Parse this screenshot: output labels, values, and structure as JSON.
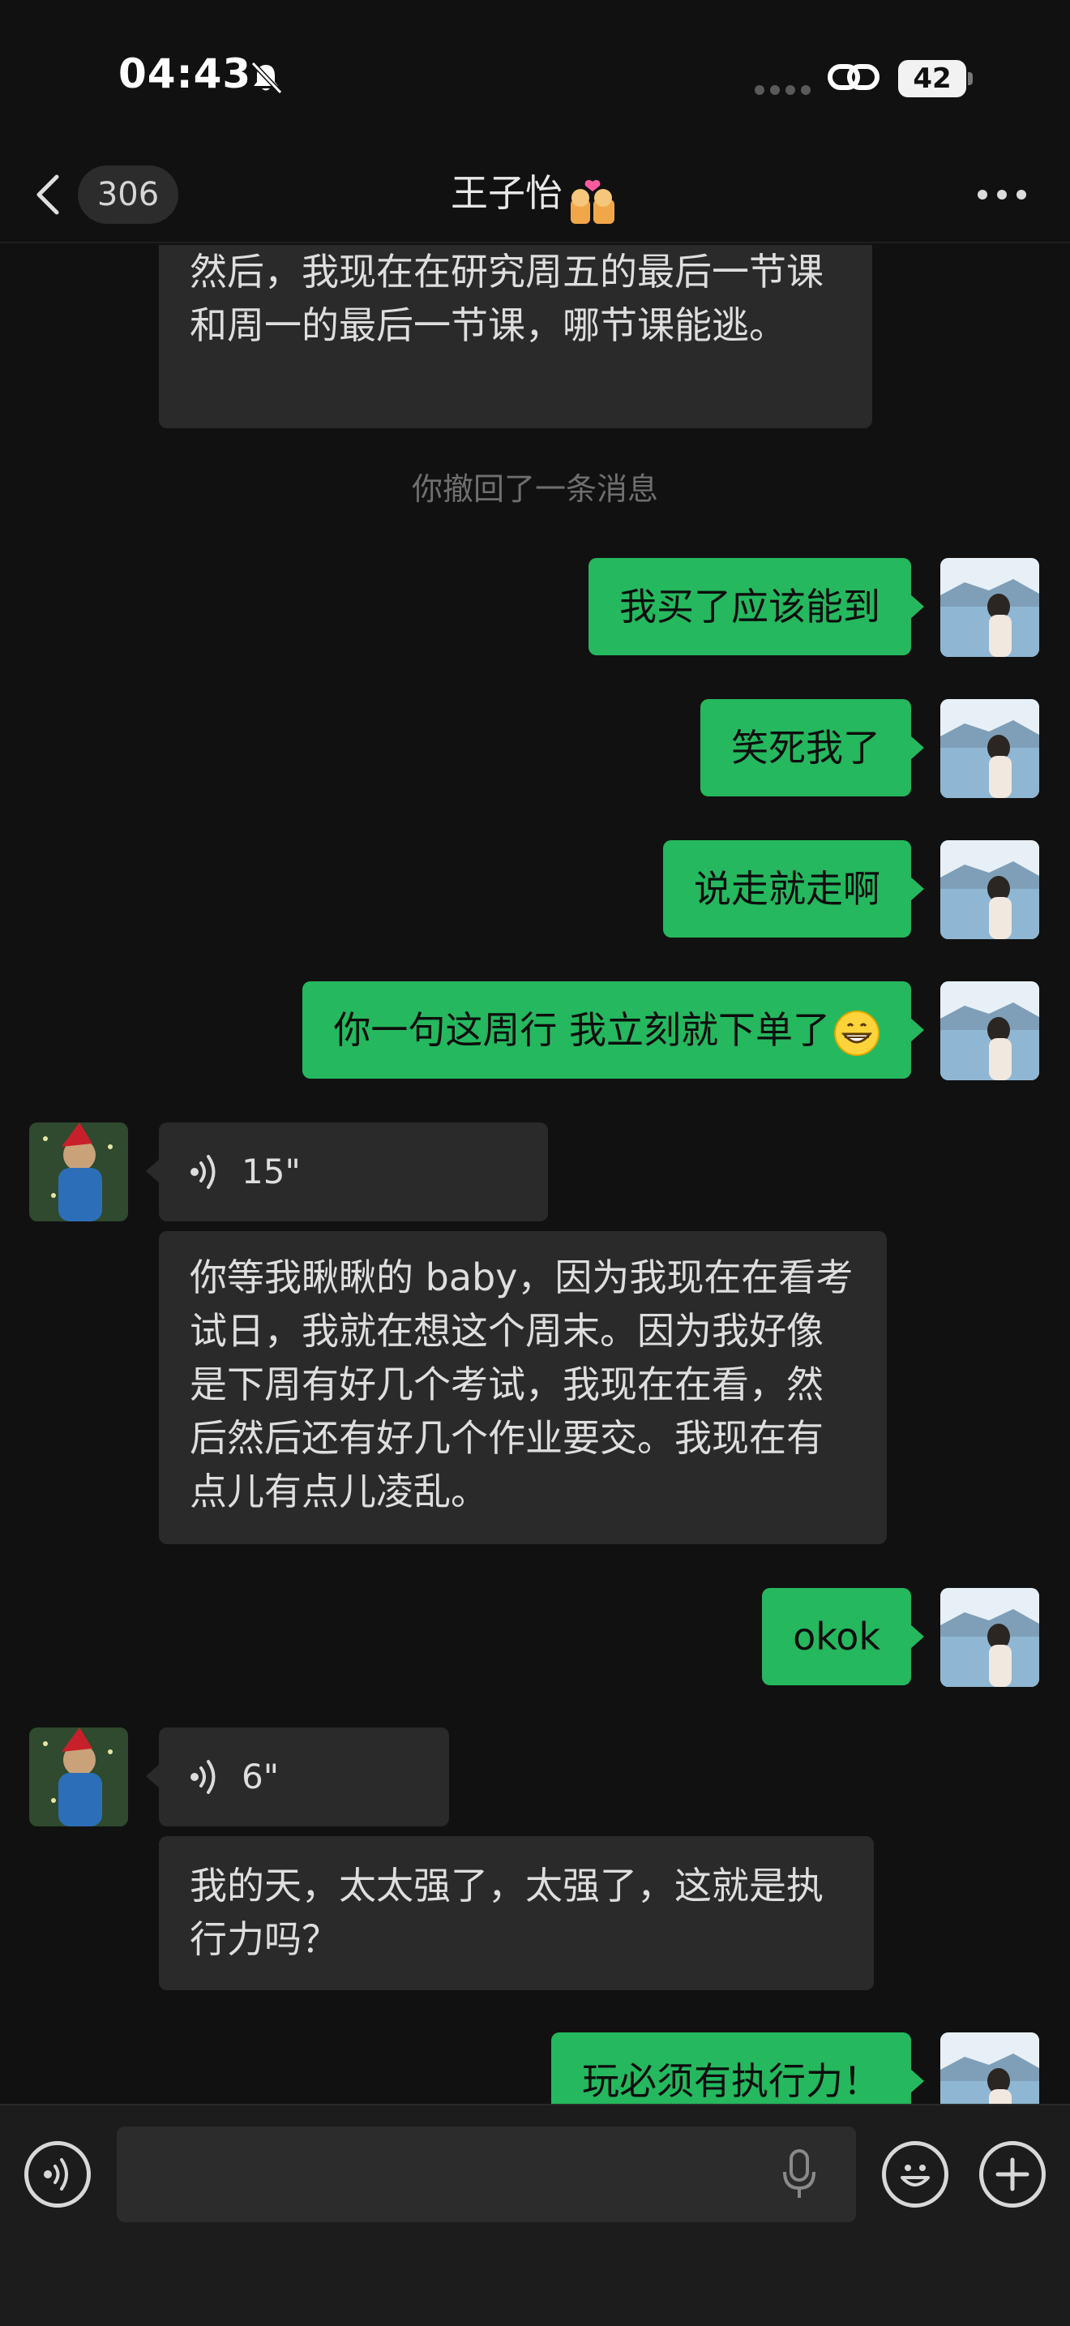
{
  "status_bar": {
    "time": "04:43",
    "battery": "42"
  },
  "nav": {
    "unread_count": "306",
    "contact_name": "王子怡",
    "title_emoji": "couple-kiss-emoji"
  },
  "messages": [
    {
      "id": "m1",
      "from": "contact",
      "type": "text",
      "text": "然后，我现在在研究周五的最后一节课和周一的最后一节课，哪节课能逃。"
    },
    {
      "id": "m2",
      "type": "system",
      "text": "你撤回了一条消息"
    },
    {
      "id": "m3",
      "from": "me",
      "type": "text",
      "text": "我买了应该能到"
    },
    {
      "id": "m4",
      "from": "me",
      "type": "text",
      "text": "笑死我了"
    },
    {
      "id": "m5",
      "from": "me",
      "type": "text",
      "text": "说走就走啊"
    },
    {
      "id": "m6",
      "from": "me",
      "type": "text",
      "text": "你一句这周行 我立刻就下单了",
      "emoji": "grinning-face-emoji"
    },
    {
      "id": "m7",
      "from": "contact",
      "type": "voice",
      "duration": "15\""
    },
    {
      "id": "m8",
      "from": "contact",
      "type": "text",
      "text": "你等我瞅瞅的 baby，因为我现在在看考试日，我就在想这个周末。因为我好像是下周有好几个考试，我现在在看，然后然后还有好几个作业要交。我现在有点儿有点儿凌乱。"
    },
    {
      "id": "m9",
      "from": "me",
      "type": "text",
      "text": "okok"
    },
    {
      "id": "m10",
      "from": "contact",
      "type": "voice",
      "duration": "6\""
    },
    {
      "id": "m11",
      "from": "contact",
      "type": "text",
      "text": "我的天，太太强了，太强了，这就是执行力吗？"
    },
    {
      "id": "m12",
      "from": "me",
      "type": "text",
      "text": "玩必须有执行力！"
    }
  ],
  "input_bar": {
    "placeholder": "",
    "left_button": "voice-mode-icon",
    "right_buttons": [
      "emoji-icon",
      "add-icon"
    ]
  },
  "colors": {
    "background": "#111111",
    "outgoing_bubble": "#25b85e",
    "incoming_bubble": "#2a2a2a",
    "system_text": "#6f6f6f"
  }
}
